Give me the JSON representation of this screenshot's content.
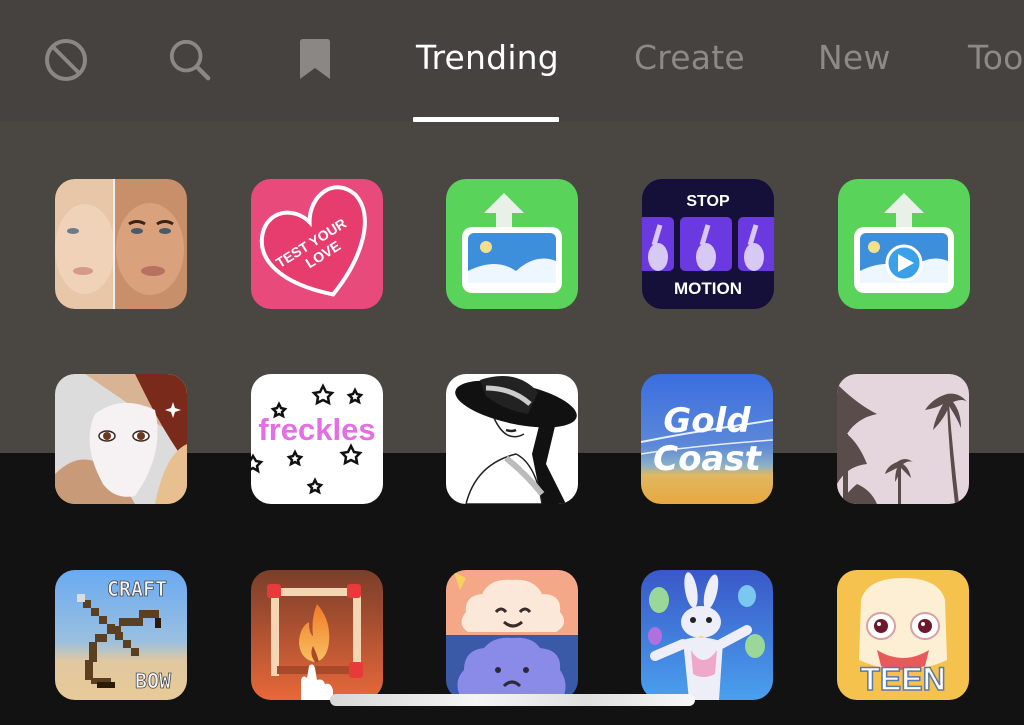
{
  "tabs": {
    "icons": [
      {
        "name": "none",
        "icon": "no-entry-icon"
      },
      {
        "name": "search",
        "icon": "search-icon"
      },
      {
        "name": "saved",
        "icon": "bookmark-icon"
      }
    ],
    "labels": [
      {
        "label": "Trending",
        "active": true
      },
      {
        "label": "Create",
        "active": false
      },
      {
        "label": "New",
        "active": false
      },
      {
        "label": "Too",
        "active": false
      }
    ]
  },
  "effects": [
    {
      "name": "beauty-before-after",
      "text": ""
    },
    {
      "name": "test-your-love",
      "text_line1": "TEST YOUR",
      "text_line2": "LOVE"
    },
    {
      "name": "upload-image",
      "text": ""
    },
    {
      "name": "stop-motion",
      "text_top": "STOP",
      "text_bottom": "MOTION"
    },
    {
      "name": "upload-video",
      "text": ""
    },
    {
      "name": "face-mask",
      "text": ""
    },
    {
      "name": "freckles",
      "text": "freckles"
    },
    {
      "name": "hat-lady-sketch",
      "text": ""
    },
    {
      "name": "gold-coast",
      "text_line1": "Gold",
      "text_line2": "Coast"
    },
    {
      "name": "palm-trees",
      "text": ""
    },
    {
      "name": "craft-bow",
      "text_top": "CRAFT",
      "text_bottom": "BOW"
    },
    {
      "name": "matchstick-fire",
      "text": ""
    },
    {
      "name": "happy-sad-cloud",
      "text": ""
    },
    {
      "name": "easter-bunny",
      "text": ""
    },
    {
      "name": "teen-face",
      "text": "TEEN"
    }
  ],
  "colors": {
    "active_tab": "#ffffff",
    "inactive_tab": "#8c8986",
    "header_bg": "#45423f",
    "panel_bg": "#4a4743",
    "bottom_bg": "#121212"
  }
}
